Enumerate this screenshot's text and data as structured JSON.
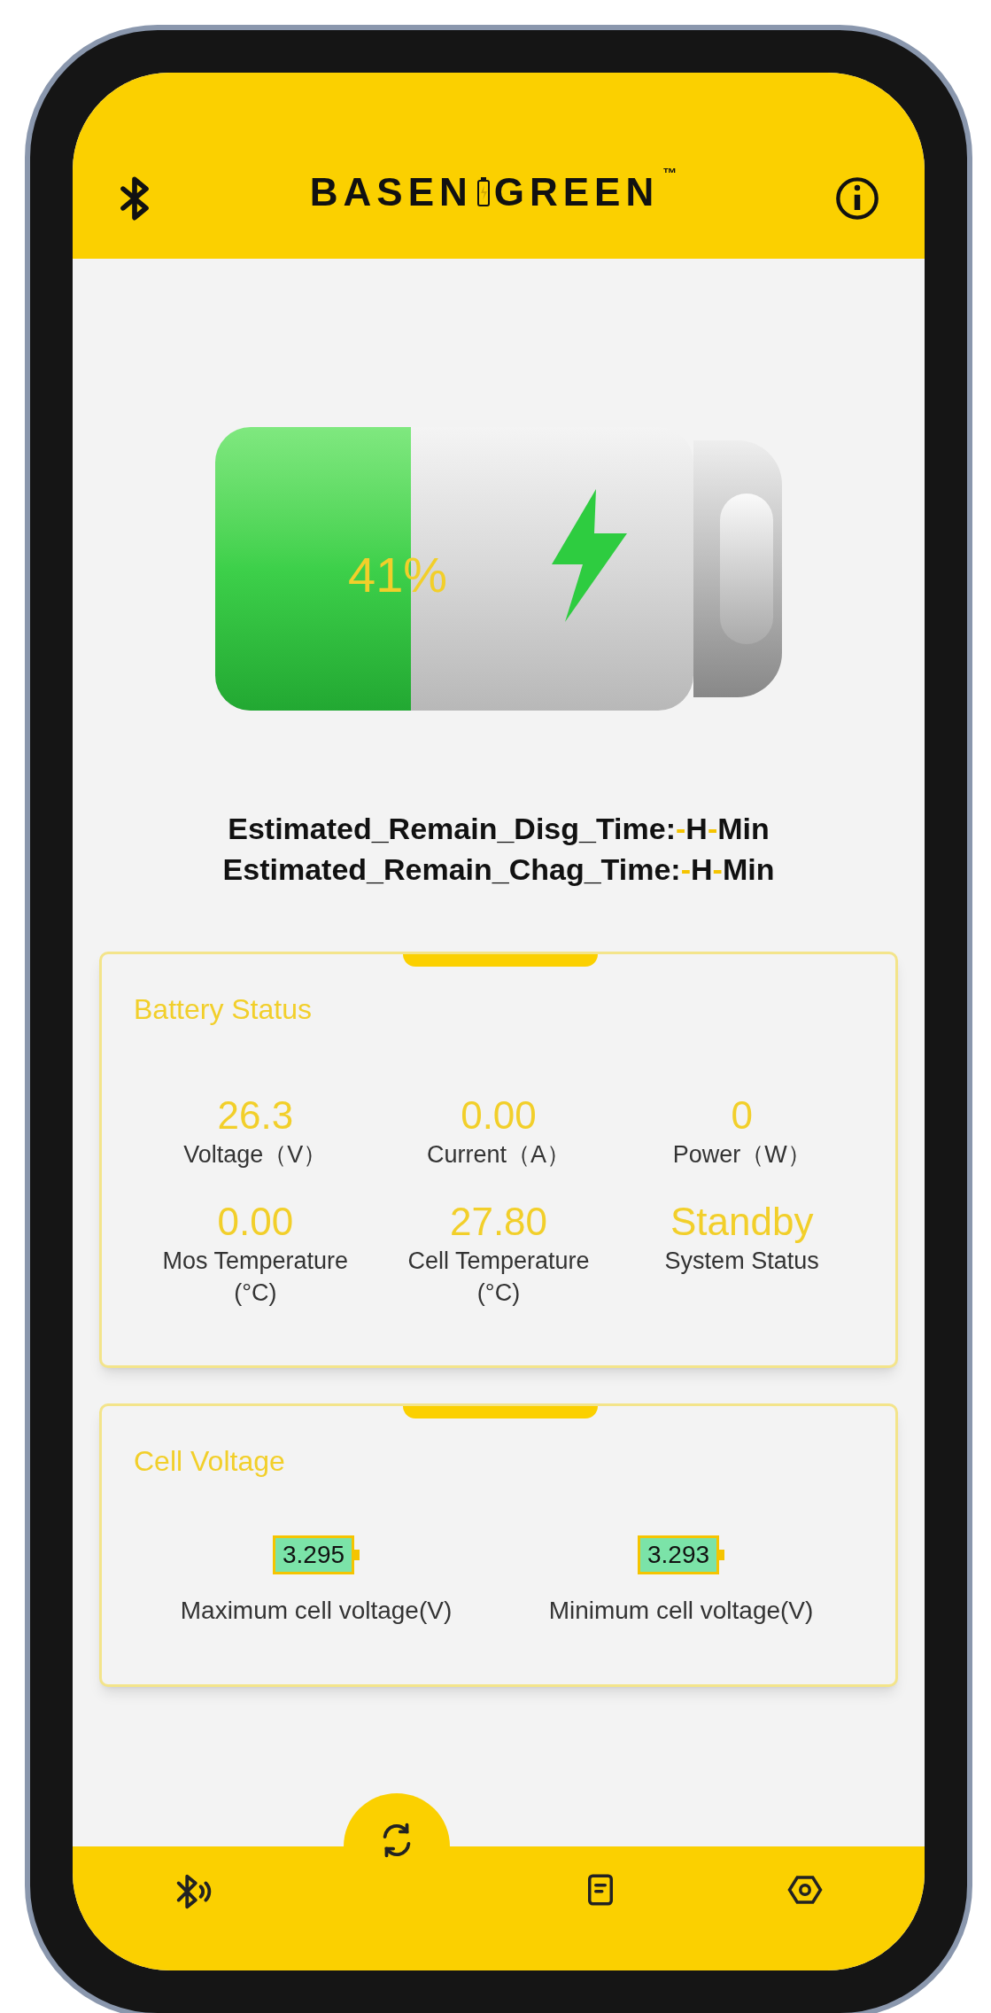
{
  "header": {
    "logo": {
      "left": "BASEN",
      "right": "GREEN",
      "mark": "™"
    }
  },
  "battery": {
    "level": 0.41,
    "percent": "41%",
    "charging": true
  },
  "estimates": [
    {
      "label": "Estimated_Remain_Disg_Time:",
      "hours": "-",
      "hours_unit": "H",
      "minutes": "-",
      "minutes_unit": "Min"
    },
    {
      "label": "Estimated_Remain_Chag_Time:",
      "hours": "-",
      "hours_unit": "H",
      "minutes": "-",
      "minutes_unit": "Min"
    }
  ],
  "battery_status": {
    "title": "Battery Status",
    "metrics": [
      {
        "value": "26.3",
        "label": "Voltage（V）"
      },
      {
        "value": "0.00",
        "label": "Current（A）"
      },
      {
        "value": "0",
        "label": "Power（W）"
      },
      {
        "value": "0.00",
        "label": "Mos Temperature\n(°C)"
      },
      {
        "value": "27.80",
        "label": "Cell Temperature\n(°C)"
      },
      {
        "value": "Standby",
        "label": "System Status"
      }
    ]
  },
  "cell_voltage": {
    "title": "Cell Voltage",
    "cells": [
      {
        "value": "3.295",
        "label": "Maximum cell voltage(V)"
      },
      {
        "value": "3.293",
        "label": "Minimum cell voltage(V)"
      }
    ]
  },
  "bottom_nav": [
    {
      "kind": "bluetooth",
      "selected": false
    },
    {
      "kind": "refresh",
      "selected": true
    },
    {
      "kind": "document",
      "selected": false
    },
    {
      "kind": "settings",
      "selected": false
    }
  ]
}
